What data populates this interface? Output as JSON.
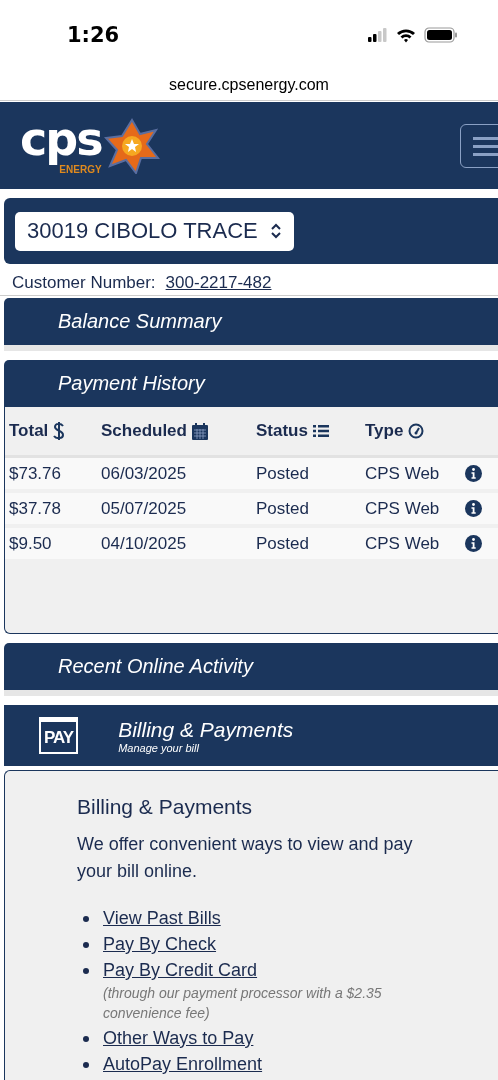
{
  "status_bar": {
    "time": "1:26"
  },
  "browser": {
    "url": "secure.cpsenergy.com"
  },
  "logo": {
    "name": "cps",
    "tag": "ENERGY"
  },
  "account": {
    "address": "30019 CIBOLO TRACE",
    "customer_label": "Customer Number:",
    "customer_number": "300-2217-482"
  },
  "sections": [
    {
      "kind": "plain",
      "title": "Balance Summary"
    },
    {
      "kind": "table",
      "title": "Payment History"
    },
    {
      "kind": "plain",
      "title": "Recent Online Activity"
    }
  ],
  "payment_table": {
    "columns": [
      {
        "label": "Total",
        "kind": "dollar"
      },
      {
        "label": "Scheduled",
        "kind": "calendar"
      },
      {
        "label": "Status",
        "kind": "list"
      },
      {
        "label": "Type",
        "kind": "gauge"
      }
    ],
    "rows": [
      {
        "total": "$73.76",
        "scheduled": "06/03/2025",
        "status": "Posted",
        "type": "CPS Web"
      },
      {
        "total": "$37.78",
        "scheduled": "05/07/2025",
        "status": "Posted",
        "type": "CPS Web"
      },
      {
        "total": "$9.50",
        "scheduled": "04/10/2025",
        "status": "Posted",
        "type": "CPS Web"
      }
    ]
  },
  "billing": {
    "badge": "PAY",
    "title": "Billing & Payments",
    "subtitle": "Manage your bill",
    "heading": "Billing & Payments",
    "intro": "We offer convenient ways to view and pay your bill online.",
    "links": [
      {
        "label": "View Past Bills"
      },
      {
        "label": "Pay By Check"
      },
      {
        "label": "Pay By Credit Card",
        "note": "(through our payment processor with a $2.35 convenience fee)"
      },
      {
        "label": "Other Ways to Pay"
      },
      {
        "label": "AutoPay Enrollment"
      }
    ]
  }
}
